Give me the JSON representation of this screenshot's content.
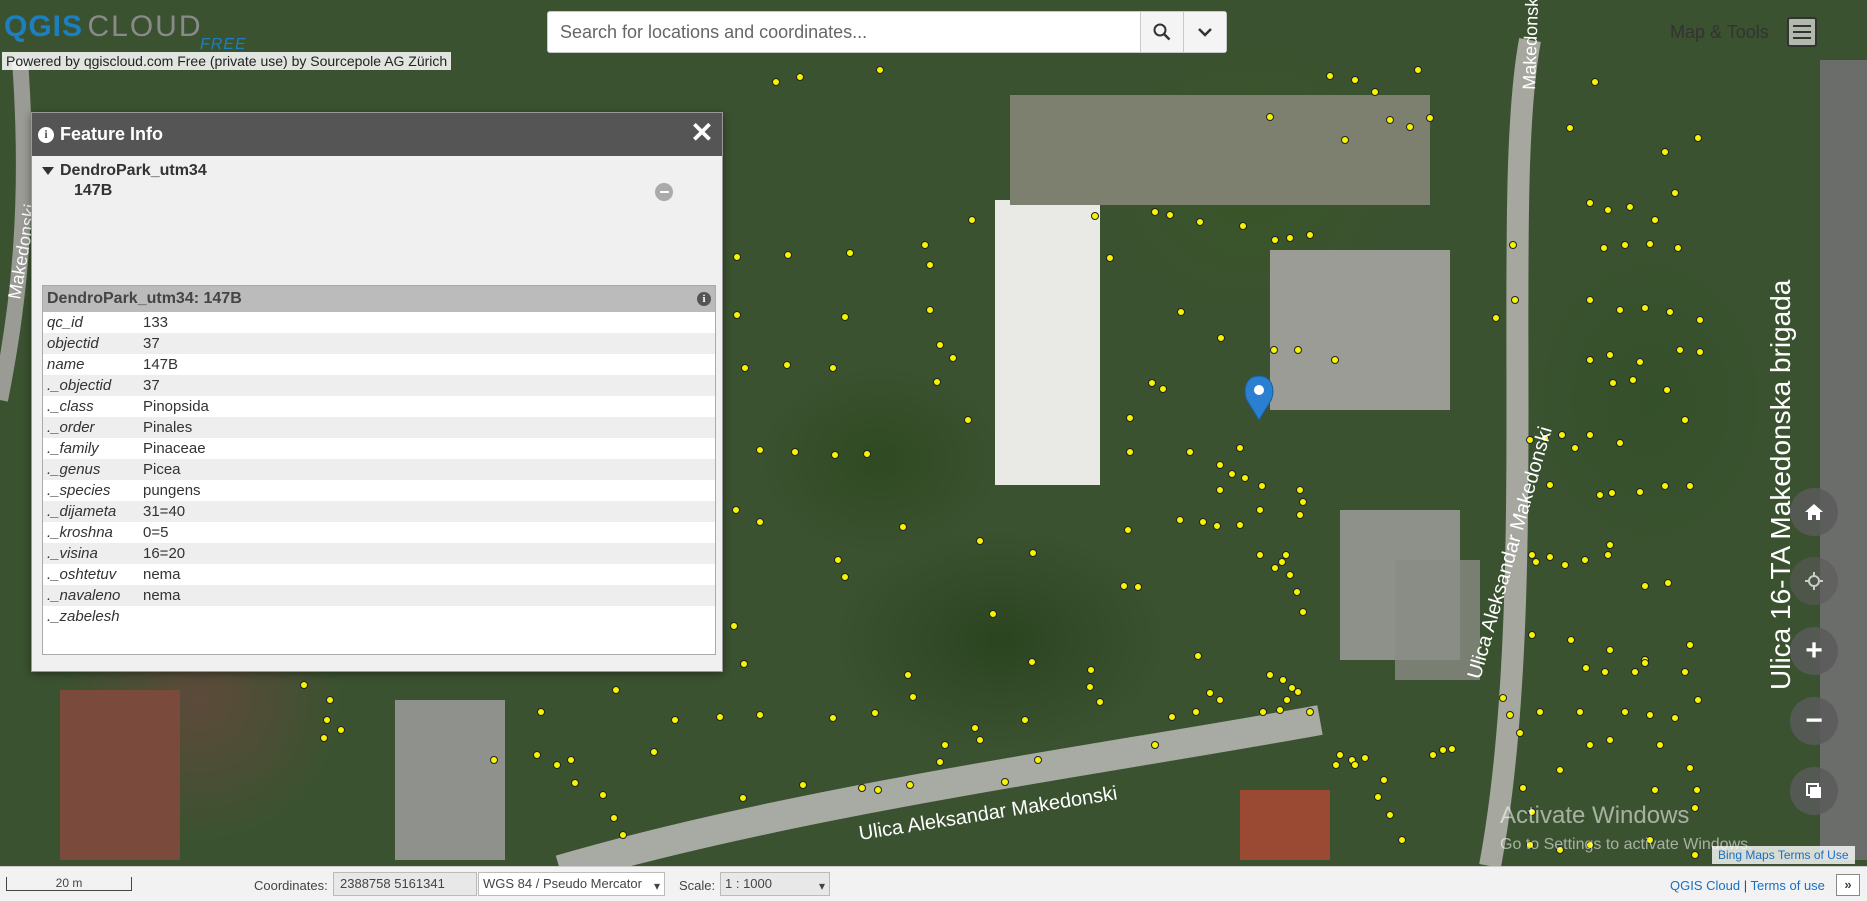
{
  "header": {
    "logo_q": "QGIS",
    "logo_cloud": "CLOUD",
    "logo_free": "FREE",
    "powered_by": "Powered by qgiscloud.com Free (private use) by Sourcepole AG Zürich",
    "search_placeholder": "Search for locations and coordinates...",
    "map_tools_label": "Map & Tools"
  },
  "feature_info": {
    "title": "Feature Info",
    "layer_name": "DendroPark_utm34",
    "feature_name": "147B",
    "table_title": "DendroPark_utm34: 147B",
    "attributes": [
      {
        "key": "qc_id",
        "value": "133"
      },
      {
        "key": "objectid",
        "value": "37"
      },
      {
        "key": "name",
        "value": "147B"
      },
      {
        "key": "._objectid",
        "value": "37"
      },
      {
        "key": "._class",
        "value": "Pinopsida"
      },
      {
        "key": "._order",
        "value": "Pinales"
      },
      {
        "key": "._family",
        "value": "Pinaceae"
      },
      {
        "key": "._genus",
        "value": "Picea"
      },
      {
        "key": "._species",
        "value": "pungens"
      },
      {
        "key": "._dijameta",
        "value": "31=40"
      },
      {
        "key": "._kroshna",
        "value": "0=5"
      },
      {
        "key": "._visina",
        "value": "16=20"
      },
      {
        "key": "._oshtetuv",
        "value": "nema"
      },
      {
        "key": "._navaleno",
        "value": "nema"
      },
      {
        "key": "._zabelesh",
        "value": ""
      }
    ]
  },
  "map": {
    "street_labels": [
      "Ulica Aleksandar Makedonski",
      "Ulica Aleksandar Makedonski",
      "Ulica 16-TA Makedonska brigada",
      "Makedonski",
      "Aleksa",
      "Makedonski"
    ],
    "watermark_1": "Activate Windows",
    "watermark_2": "Go to Settings to activate Windows.",
    "attribution": "Bing Maps Terms of Use"
  },
  "controls": {
    "home": "home-icon",
    "locate": "locate-icon",
    "zoom_in": "+",
    "zoom_out": "−",
    "layers": "layers-icon"
  },
  "footer": {
    "scale_text": "20 m",
    "coordinates_label": "Coordinates:",
    "coordinates_value": "2388758 5161341",
    "crs": "WGS 84 / Pseudo Mercator",
    "scale_label": "Scale:",
    "scale_value": "1 : 1000",
    "link_qgis_cloud": "QGIS Cloud",
    "link_separator": "|",
    "link_terms": "Terms of use",
    "expand": "»"
  }
}
